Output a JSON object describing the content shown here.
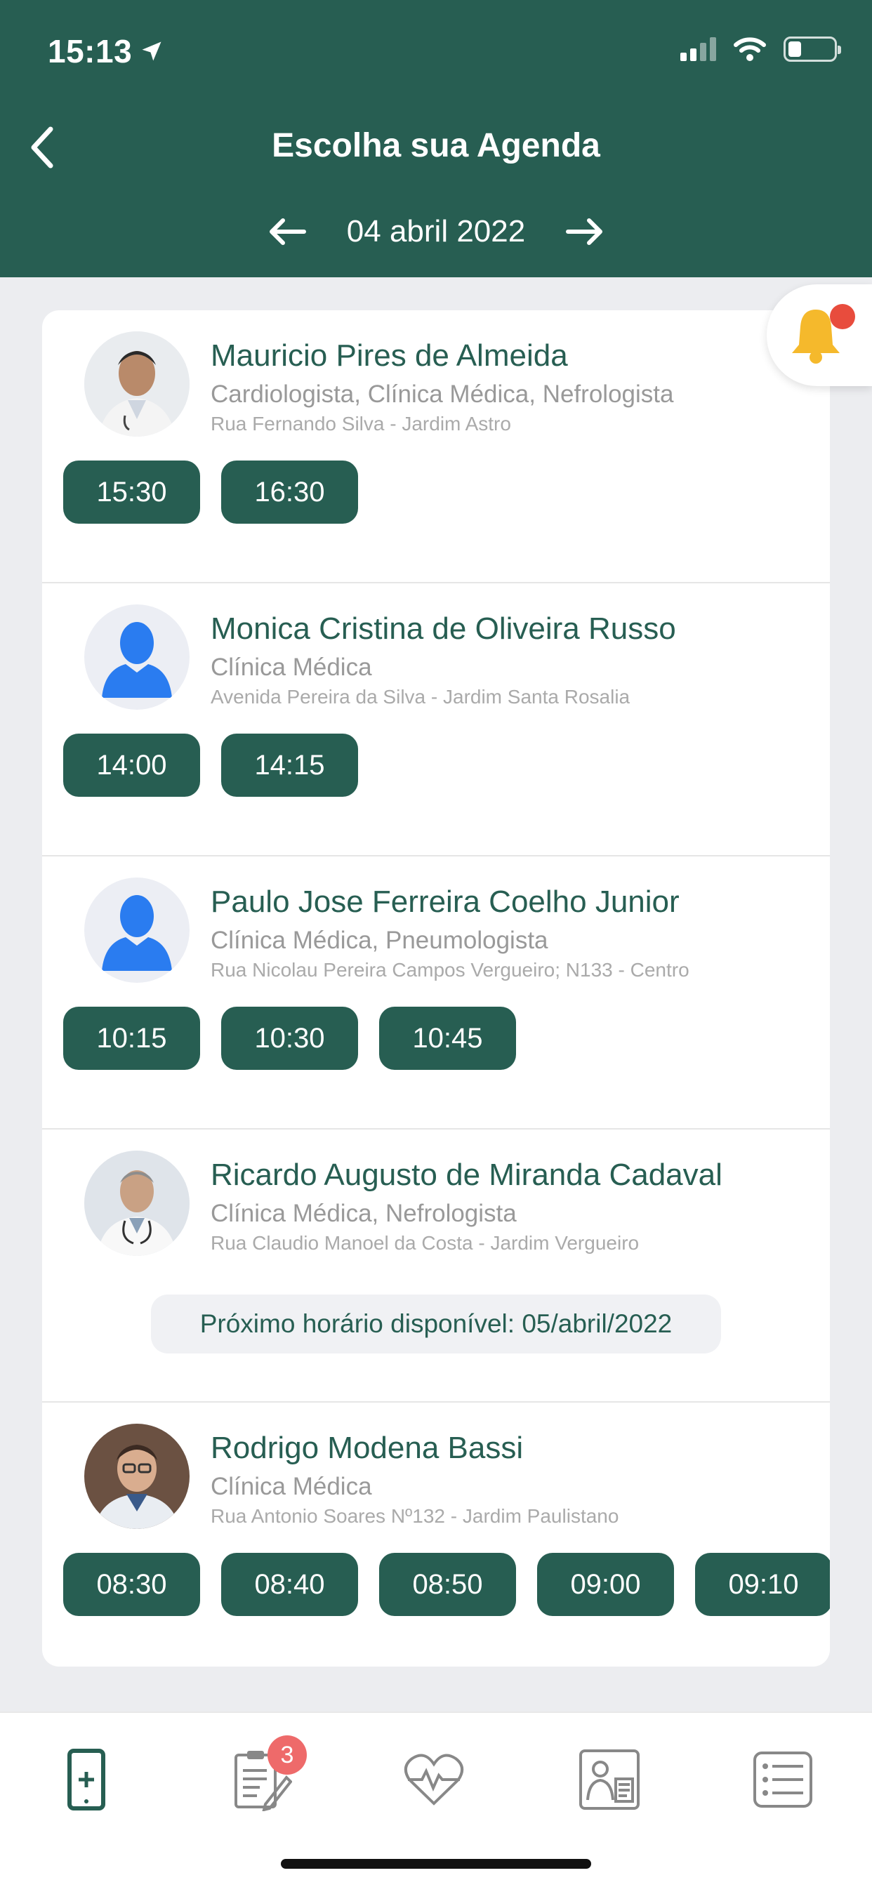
{
  "status": {
    "time": "15:13"
  },
  "header": {
    "title": "Escolha sua Agenda",
    "date": "04 abril 2022"
  },
  "doctors": [
    {
      "name": "Mauricio Pires de Almeida",
      "specialties": "Cardiologista, Clínica Médica, Nefrologista",
      "address": "Rua Fernando Silva - Jardim Astro",
      "avatar": "photo",
      "slots": [
        "15:30",
        "16:30"
      ]
    },
    {
      "name": "Monica Cristina de Oliveira Russo",
      "specialties": "Clínica Médica",
      "address": "Avenida Pereira da Silva - Jardim Santa Rosalia",
      "avatar": "placeholder",
      "slots": [
        "14:00",
        "14:15"
      ]
    },
    {
      "name": "Paulo Jose Ferreira Coelho Junior",
      "specialties": "Clínica Médica, Pneumologista",
      "address": "Rua Nicolau Pereira Campos Vergueiro; N133 - Centro",
      "avatar": "placeholder",
      "slots": [
        "10:15",
        "10:30",
        "10:45"
      ]
    },
    {
      "name": "Ricardo Augusto de Miranda Cadaval",
      "specialties": "Clínica Médica, Nefrologista",
      "address": "Rua Claudio Manoel da Costa - Jardim Vergueiro",
      "avatar": "photo",
      "next_available": "Próximo horário disponível: 05/abril/2022"
    },
    {
      "name": "Rodrigo Modena Bassi",
      "specialties": "Clínica Médica",
      "address": "Rua Antonio Soares Nº132 - Jardim Paulistano",
      "avatar": "photo",
      "slots": [
        "08:30",
        "08:40",
        "08:50",
        "09:00",
        "09:10"
      ]
    }
  ],
  "tabbar": {
    "tabs": [
      {
        "icon": "phone-plus-icon",
        "active": true
      },
      {
        "icon": "clipboard-edit-icon",
        "badge": "3"
      },
      {
        "icon": "heart-pulse-icon"
      },
      {
        "icon": "doctor-card-icon"
      },
      {
        "icon": "list-icon"
      }
    ]
  },
  "colors": {
    "primary": "#275e52",
    "badge": "#ee6a6a",
    "bell_dot": "#e84c3d"
  }
}
